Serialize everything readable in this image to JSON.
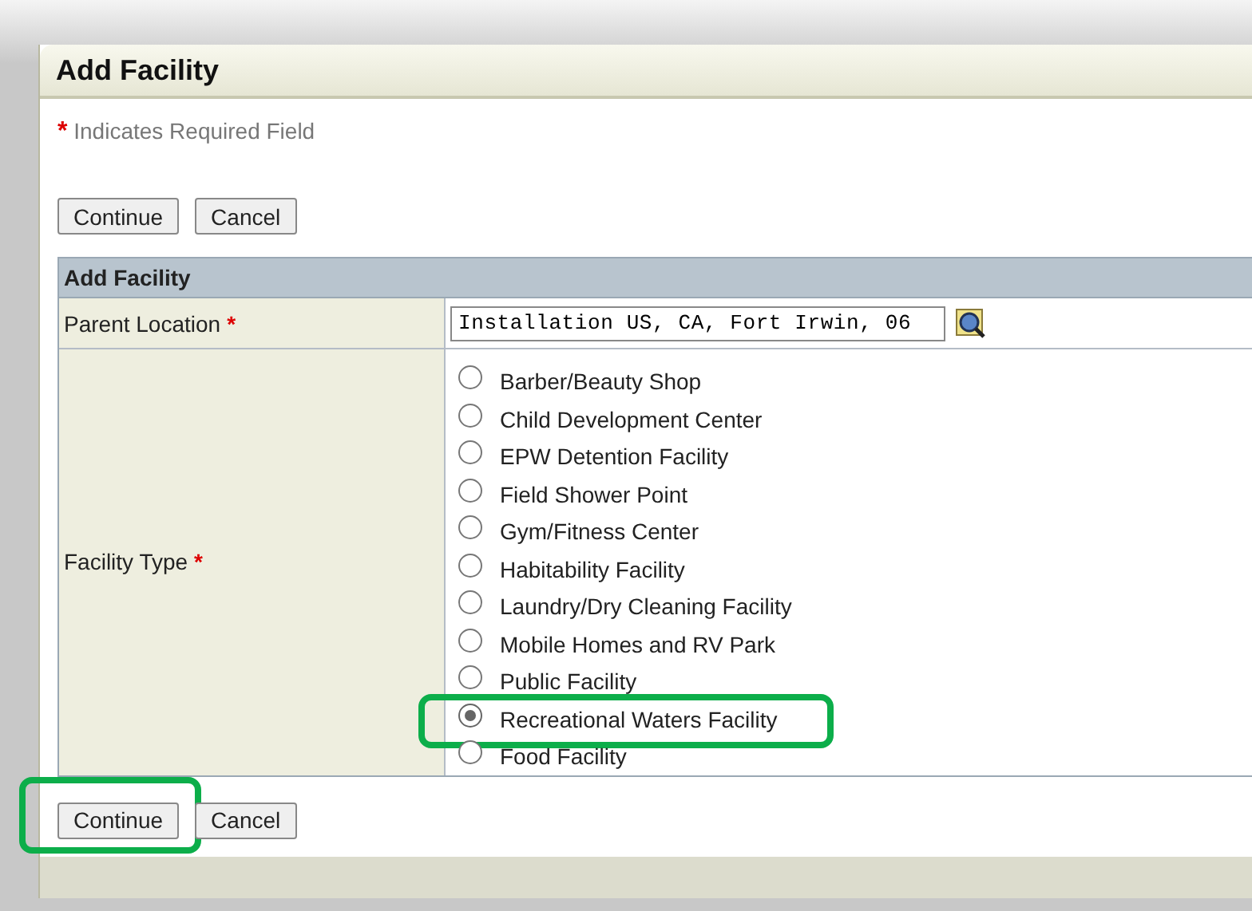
{
  "window": {
    "title": "Add Facility"
  },
  "required_note": {
    "mark": "*",
    "text": "Indicates Required Field"
  },
  "top_buttons": [
    {
      "label": "Continue",
      "highlighted": false
    },
    {
      "label": "Cancel",
      "highlighted": false
    }
  ],
  "form": {
    "title": "Add Facility",
    "parent_location": {
      "label": "Parent Location",
      "required_mark": "*",
      "value": "Installation US, CA, Fort Irwin, 06"
    },
    "facility_type": {
      "label": "Facility Type",
      "required_mark": "*",
      "options": [
        {
          "label": "Barber/Beauty Shop",
          "selected": false,
          "highlighted": false
        },
        {
          "label": "Child Development Center",
          "selected": false,
          "highlighted": false
        },
        {
          "label": "EPW Detention Facility",
          "selected": false,
          "highlighted": false
        },
        {
          "label": "Field Shower Point",
          "selected": false,
          "highlighted": false
        },
        {
          "label": "Gym/Fitness Center",
          "selected": false,
          "highlighted": false
        },
        {
          "label": "Habitability Facility",
          "selected": false,
          "highlighted": false
        },
        {
          "label": "Laundry/Dry Cleaning Facility",
          "selected": false,
          "highlighted": false
        },
        {
          "label": "Mobile Homes and RV Park",
          "selected": false,
          "highlighted": false
        },
        {
          "label": "Public Facility",
          "selected": false,
          "highlighted": false
        },
        {
          "label": "Recreational Waters Facility",
          "selected": true,
          "highlighted": true
        },
        {
          "label": "Food Facility",
          "selected": false,
          "highlighted": false
        }
      ]
    }
  },
  "bottom_buttons": [
    {
      "label": "Continue",
      "highlighted": true
    },
    {
      "label": "Cancel",
      "highlighted": false
    }
  ]
}
